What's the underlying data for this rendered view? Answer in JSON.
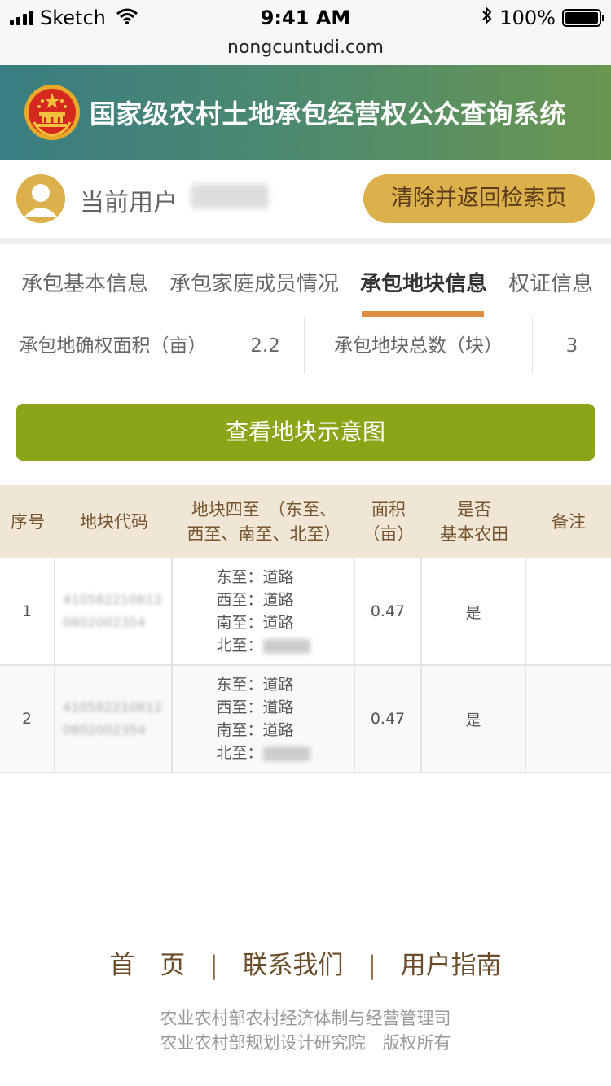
{
  "status_bar": {
    "carrier": "Sketch",
    "time": "9:41 AM",
    "battery": "100%",
    "battery_level": 1.0
  },
  "browser": {
    "url": "nongcuntudi.com"
  },
  "header": {
    "title": "国家级农村土地承包经营权公众查询系统",
    "emblem_colors": {
      "gold": "#f2c23d",
      "red": "#d5281e"
    }
  },
  "user": {
    "label": "当前用户",
    "name": "马良喜",
    "clear_button": "清除并返回检索页"
  },
  "tabs": [
    {
      "label": "承包基本信息",
      "active": false
    },
    {
      "label": "承包家庭成员情况",
      "active": false
    },
    {
      "label": "承包地块信息",
      "active": true
    },
    {
      "label": "权证信息",
      "active": false
    }
  ],
  "summary": {
    "area_label": "承包地确权面积（亩）",
    "area_value": "2.2",
    "count_label": "承包地块总数（块）",
    "count_value": "3"
  },
  "map_button": "查看地块示意图",
  "table": {
    "headers": {
      "index": "序号",
      "code": "地块代码",
      "bounds_line1": "地块四至　（东至、",
      "bounds_line2": "西至、南至、北至）",
      "area_line1": "面积",
      "area_line2": "（亩）",
      "basic_line1": "是否",
      "basic_line2": "基本农田",
      "remark": "备注"
    },
    "rows": [
      {
        "index": "1",
        "code": "4105822106120802002354",
        "east": "东至：道路",
        "west": "西至：道路",
        "south": "南至：道路",
        "north": "北至：",
        "north_name": "马良喜",
        "area": "0.47",
        "basic": "是",
        "remark": ""
      },
      {
        "index": "2",
        "code": "4105822106120802002354",
        "east": "东至：道路",
        "west": "西至：道路",
        "south": "南至：道路",
        "north": "北至：",
        "north_name": "马良喜",
        "area": "0.47",
        "basic": "是",
        "remark": ""
      }
    ]
  },
  "footer": {
    "links": [
      "首　页",
      "联系我们",
      "用户指南"
    ],
    "separator": "|",
    "copyright_line1": "农业农村部农村经济体制与经营管理司",
    "copyright_line2": "农业农村部规划设计研究院　版权所有"
  },
  "colors": {
    "accent_gold": "#dcb04a",
    "action_green": "#8aa517",
    "tab_underline": "#dd8e43",
    "table_header_bg": "#efe6d5"
  }
}
